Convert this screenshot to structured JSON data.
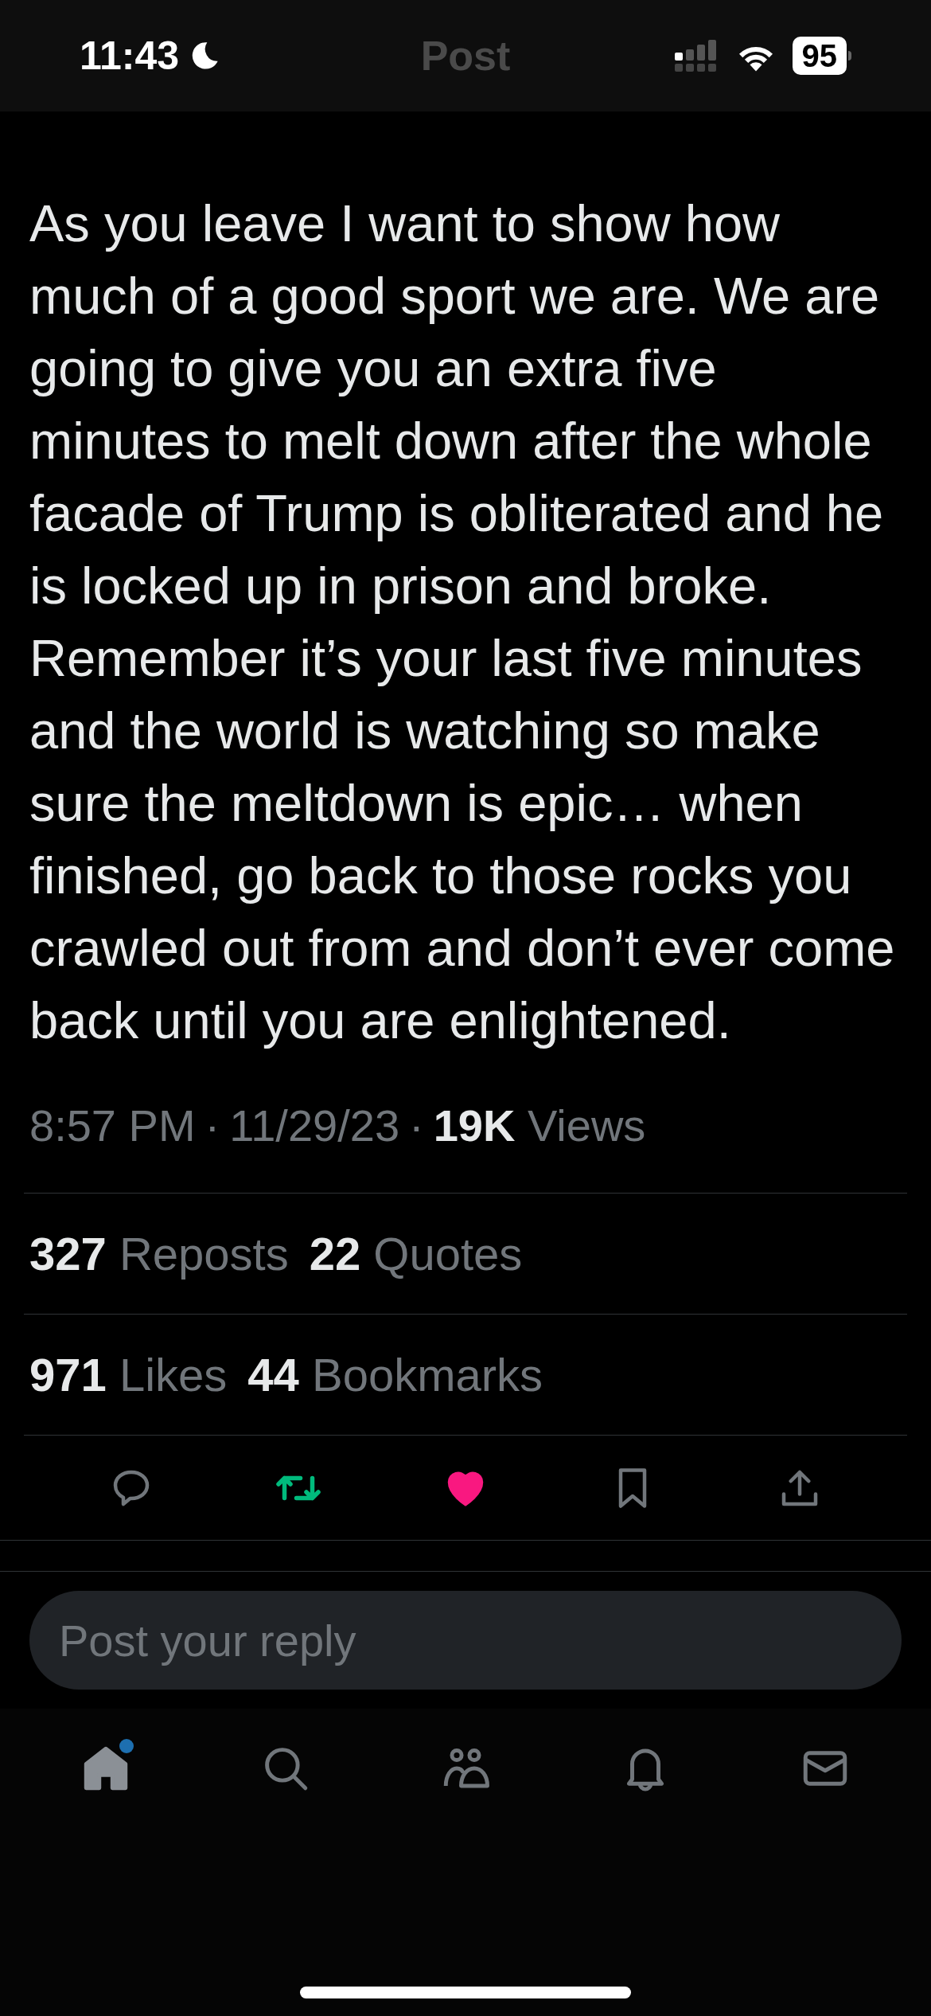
{
  "status_bar": {
    "time": "11:43",
    "battery": "95"
  },
  "header": {
    "title": "Post"
  },
  "post": {
    "text": "As you leave I want to show how much of a good sport we are. We are going to give you an extra five minutes to melt down after the whole facade of Trump is obliterated and he is locked up in prison and broke. Remember it’s your last five minutes and the world is watching so make sure the meltdown is epic… when finished, go back to those rocks you crawled out from and don’t ever come back until you are enlightened.",
    "time": "8:57 PM",
    "separator": "·",
    "date": "11/29/23",
    "views_count": "19K",
    "views_label": "Views"
  },
  "stats": [
    [
      {
        "count": "327",
        "label": "Reposts"
      },
      {
        "count": "22",
        "label": "Quotes"
      }
    ],
    [
      {
        "count": "971",
        "label": "Likes"
      },
      {
        "count": "44",
        "label": "Bookmarks"
      }
    ]
  ],
  "actions": [
    {
      "kind": "reply",
      "active": false
    },
    {
      "kind": "repost",
      "active": true
    },
    {
      "kind": "like",
      "active": true
    },
    {
      "kind": "bookmark",
      "active": false
    },
    {
      "kind": "share",
      "active": false
    }
  ],
  "reply_field": {
    "placeholder": "Post your reply"
  },
  "nav": [
    {
      "kind": "home",
      "selected": true,
      "badge": true
    },
    {
      "kind": "search",
      "selected": false,
      "badge": false
    },
    {
      "kind": "communities",
      "selected": false,
      "badge": false
    },
    {
      "kind": "notifications",
      "selected": false,
      "badge": false
    },
    {
      "kind": "messages",
      "selected": false,
      "badge": false
    }
  ]
}
